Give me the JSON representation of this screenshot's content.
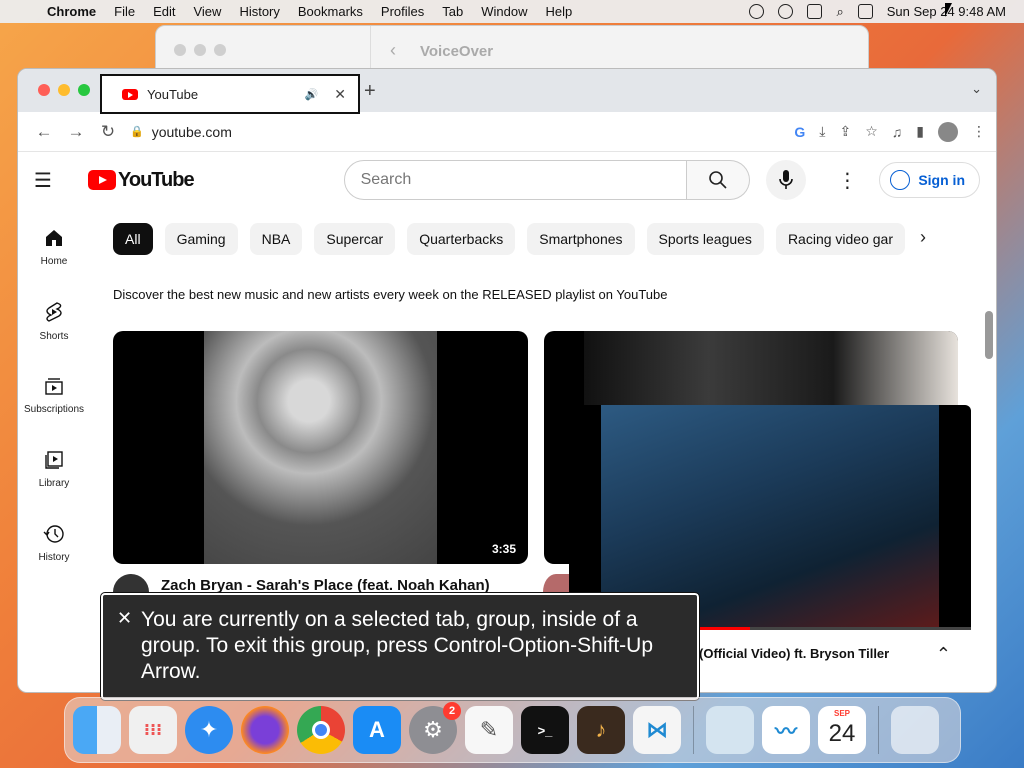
{
  "menubar": {
    "app": "Chrome",
    "items": [
      "File",
      "Edit",
      "View",
      "History",
      "Bookmarks",
      "Profiles",
      "Tab",
      "Window",
      "Help"
    ],
    "clock": "Sun Sep 24  9:48 AM"
  },
  "voiceover_window": {
    "title": "VoiceOver"
  },
  "tab": {
    "title": "YouTube",
    "audio_icon": "speaker-icon",
    "close_glyph": "✕"
  },
  "toolbar": {
    "url": "youtube.com"
  },
  "youtube": {
    "logo_text": "YouTube",
    "search_placeholder": "Search",
    "signin_label": "Sign in",
    "sidebar": [
      {
        "label": "Home",
        "icon": "home-icon"
      },
      {
        "label": "Shorts",
        "icon": "shorts-icon"
      },
      {
        "label": "Subscriptions",
        "icon": "subscriptions-icon"
      },
      {
        "label": "Library",
        "icon": "library-icon"
      },
      {
        "label": "History",
        "icon": "history-icon"
      }
    ],
    "chips": [
      "All",
      "Gaming",
      "NBA",
      "Supercar",
      "Quarterbacks",
      "Smartphones",
      "Sports leagues",
      "Racing video gar"
    ],
    "promo_text": "Discover the best new music and new artists every week on the RELEASED playlist on YouTube",
    "video1": {
      "title": "Zach Bryan - Sarah's Place (feat. Noah Kahan)",
      "duration": "3:35"
    },
    "pip": {
      "title": "(Official Video) ft. Bryson Tiller",
      "progress": 0.45
    }
  },
  "voiceover_caption": {
    "text": "You are currently on a selected tab, group, inside of a group.  To exit this group, press Control-Option-Shift-Up Arrow."
  },
  "dock": {
    "apps": [
      "finder",
      "launchpad",
      "safari",
      "firefox",
      "chrome",
      "app-store",
      "system-settings",
      "textedit",
      "terminal",
      "garageband",
      "vscode",
      "preview",
      "freeform",
      "calendar",
      "trash"
    ],
    "settings_badge": "2",
    "calendar_month": "SEP",
    "calendar_day": "24"
  }
}
